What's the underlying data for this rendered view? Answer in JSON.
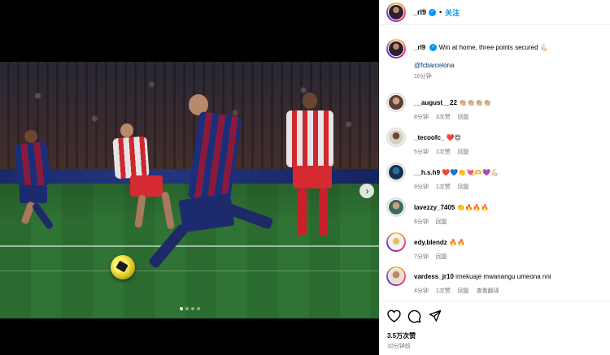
{
  "header": {
    "username": "_rl9",
    "verified_glyph": "✓",
    "separator": "•",
    "follow_label": "关注"
  },
  "caption": {
    "username": "_rl9",
    "text": "Win at home, three points secured 💪🏻",
    "mention": "@fcbarcelona",
    "time": "10分钟"
  },
  "comments": [
    {
      "username": "__august__22",
      "text": "👏🏼👏🏼👏🏼👏🏼",
      "time": "8分钟",
      "likes": "3次赞",
      "reply": "回复"
    },
    {
      "username": "_tecoofc_",
      "text": "❤️😍",
      "time": "5分钟",
      "likes": "1次赞",
      "reply": "回复"
    },
    {
      "username": "__h.s.h9",
      "text": "❤️💙👏💘🫶💜💪🏻",
      "time": "9分钟",
      "likes": "1次赞",
      "reply": "回复"
    },
    {
      "username": "lavezzy_7405",
      "text": "👏🔥🔥🔥",
      "time": "6分钟",
      "likes": "",
      "reply": "回复"
    },
    {
      "username": "edy.blendz",
      "text": "🔥🔥",
      "time": "7分钟",
      "likes": "",
      "reply": "回复"
    },
    {
      "username": "vardess_jr10",
      "text": "imekuaje mwanangu umeona nni",
      "time": "4分钟",
      "likes": "1次赞",
      "reply": "回复",
      "translate": "查看翻译"
    }
  ],
  "footer": {
    "likes": "3.5万次赞",
    "posted": "10分钟前"
  },
  "icons": {
    "like": "heart-icon",
    "comment": "comment-icon",
    "share": "share-icon",
    "next": "chevron-right-icon",
    "next_glyph": "›"
  },
  "carousel": {
    "slides": 4,
    "active": 1
  }
}
